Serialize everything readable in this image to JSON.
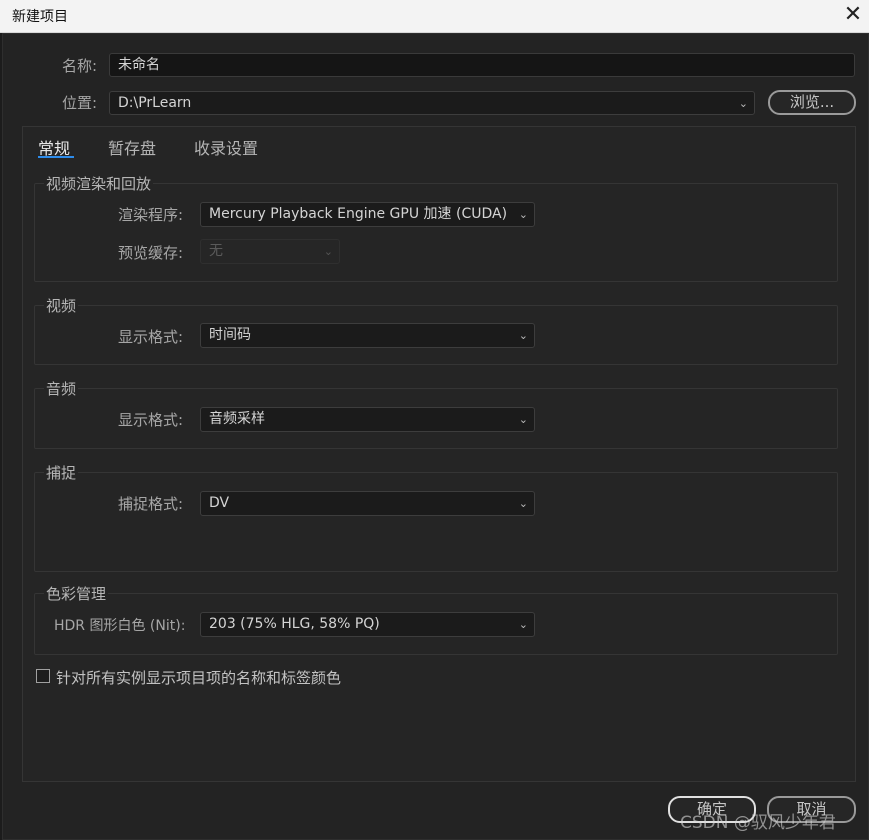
{
  "window": {
    "title": "新建项目",
    "close_glyph": "✕"
  },
  "name": {
    "label": "名称:",
    "value": "未命名"
  },
  "location": {
    "label": "位置:",
    "value": "D:\\PrLearn",
    "browse_label": "浏览..."
  },
  "tabs": [
    {
      "label": "常规",
      "active": true
    },
    {
      "label": "暂存盘",
      "active": false
    },
    {
      "label": "收录设置",
      "active": false
    }
  ],
  "render_group": {
    "title": "视频渲染和回放",
    "renderer_label": "渲染程序:",
    "renderer_value": "Mercury Playback Engine GPU 加速 (CUDA)",
    "preview_cache_label": "预览缓存:",
    "preview_cache_value": "无"
  },
  "video_group": {
    "title": "视频",
    "display_format_label": "显示格式:",
    "display_format_value": "时间码"
  },
  "audio_group": {
    "title": "音频",
    "display_format_label": "显示格式:",
    "display_format_value": "音频采样"
  },
  "capture_group": {
    "title": "捕捉",
    "capture_format_label": "捕捉格式:",
    "capture_format_value": "DV"
  },
  "color_group": {
    "title": "色彩管理",
    "hdr_label": "HDR 图形白色 (Nit):",
    "hdr_value": "203 (75% HLG, 58% PQ)"
  },
  "checkbox": {
    "label": "针对所有实例显示项目项的名称和标签颜色",
    "checked": false
  },
  "footer": {
    "ok_label": "确定",
    "cancel_label": "取消"
  },
  "watermark": "CSDN @驭风少年君",
  "icons": {
    "dropdown": "chevron-down-icon"
  },
  "colors": {
    "tab_accent": "#2d8ceb",
    "background": "#232323"
  }
}
